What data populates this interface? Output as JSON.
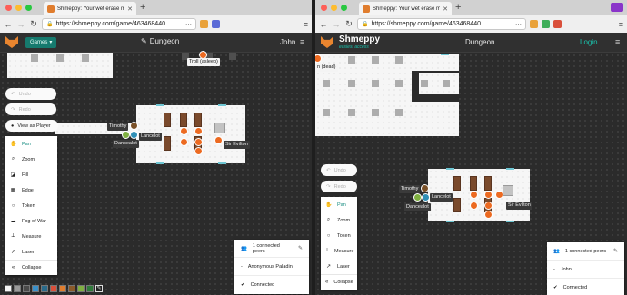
{
  "left": {
    "tab_title": "Shmeppy: Your wet erase ma",
    "url": "https://shmeppy.com/game/463468440",
    "games_label": "Games",
    "dungeon_title": "Dungeon",
    "user_name": "John",
    "left_pills": [
      "Undo",
      "Redo"
    ],
    "view_as_player": "View as Player",
    "tools": [
      "Pan",
      "Zoom",
      "Fill",
      "Edge",
      "Token",
      "Fog of War",
      "Measure",
      "Laser"
    ],
    "collapse": "Collapse",
    "tokens": {
      "troll": "Troll (asleep)",
      "timothy": "Timothy",
      "lancelot": "Lancelot",
      "dancealot": "Dancealot",
      "sir_evilton": "Sir Evilton"
    },
    "peers": {
      "count": "1 connected peers",
      "peer": "Anonymous Paladin",
      "status": "Connected"
    },
    "swatch_colors": [
      "#f5f5f5",
      "#9a9a9a",
      "#4a4a4a",
      "#3a8fc8",
      "#2a6a8a",
      "#d94f3a",
      "#e07d2e",
      "#8a5a2a",
      "#7fb041",
      "#2f7a3a"
    ]
  },
  "right": {
    "tab_title": "Shmeppy: Your wet erase ma",
    "url": "https://shmeppy.com/game/463468440",
    "brand_name": "Shmeppy",
    "brand_tag": "easiest access",
    "dungeon_title": "Dungeon",
    "login": "Login",
    "left_pills": [
      "Undo",
      "Redo"
    ],
    "tools": [
      "Pan",
      "Zoom",
      "Token",
      "Measure",
      "Laser"
    ],
    "collapse": "Collapse",
    "tokens": {
      "dead": "n (dead)",
      "timothy": "Timothy",
      "lancelot": "Lancelot",
      "dancealot": "Dancealot",
      "sir_evilton": "Sir Evilton"
    },
    "peers": {
      "count": "1 connected peers",
      "peer": "John",
      "status": "Connected"
    }
  },
  "colors": {
    "accent": "#19c3ad",
    "token_orange": "#ec6a21",
    "canvas": "#2b2b2b"
  },
  "icons": {
    "pan": "hand-icon",
    "zoom": "search-icon",
    "fill": "paint-icon",
    "edge": "edge-icon",
    "token": "circle-icon",
    "fog": "cloud-icon",
    "measure": "ruler-icon",
    "laser": "laser-icon",
    "collapse": "chevron-double-left-icon",
    "peers": "people-icon",
    "connected": "check-circle-icon"
  }
}
